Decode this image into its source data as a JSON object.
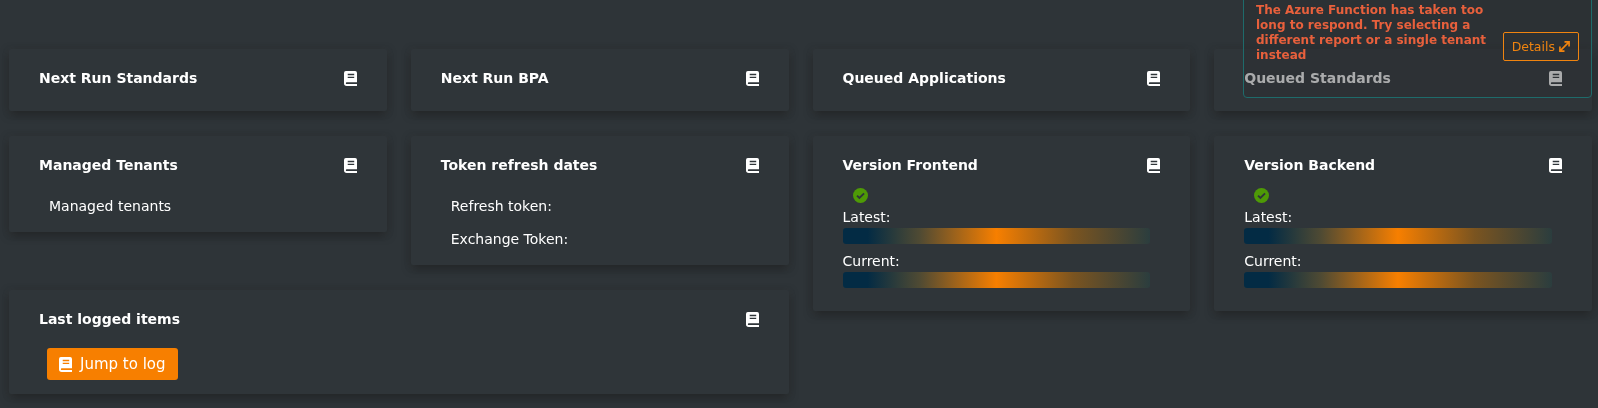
{
  "cards": [
    {
      "title": "Next Run Standards",
      "kind": "plain"
    },
    {
      "title": "Next Run BPA",
      "kind": "plain"
    },
    {
      "title": "Queued Applications",
      "kind": "plain"
    },
    {
      "title": "Queued Standards",
      "kind": "plain"
    },
    {
      "title": "Managed Tenants",
      "kind": "text",
      "lines": [
        "Managed tenants"
      ]
    },
    {
      "title": "Token refresh dates",
      "kind": "text",
      "lines": [
        "Refresh token:",
        "Exchange Token:"
      ]
    },
    {
      "title": "Version Frontend",
      "kind": "version",
      "ok": true,
      "labels": [
        "Latest:",
        "Current:"
      ]
    },
    {
      "title": "Version Backend",
      "kind": "version",
      "ok": true,
      "labels": [
        "Latest:",
        "Current:"
      ]
    },
    {
      "title": "Last logged items",
      "kind": "log",
      "button": "Jump to log"
    }
  ],
  "toast": {
    "message": "The Azure Function has taken too long to respond. Try selecting a different report or a single tenant instead",
    "button": "Details"
  }
}
